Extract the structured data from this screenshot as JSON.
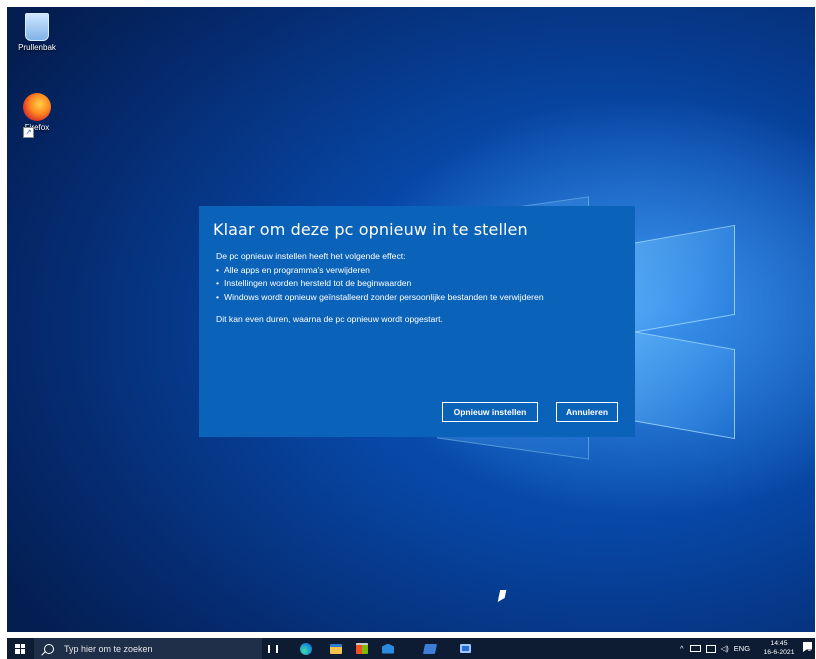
{
  "desktop": {
    "icons": [
      {
        "label": "Prullenbak",
        "icon": "recycle-bin-icon"
      },
      {
        "label": "Firefox",
        "icon": "firefox-icon"
      }
    ]
  },
  "dialog": {
    "title": "Klaar om deze pc opnieuw in te stellen",
    "intro": "De pc opnieuw instellen heeft het volgende effect:",
    "bullets": [
      "Alle apps en programma's verwijderen",
      "Instellingen worden hersteld tot de beginwaarden",
      "Windows wordt opnieuw geïnstalleerd zonder persoonlijke bestanden te verwijderen"
    ],
    "note": "Dit kan even duren, waarna de pc opnieuw wordt opgestart.",
    "reset_label": "Opnieuw instellen",
    "cancel_label": "Annuleren",
    "background": "#0a63b8"
  },
  "taskbar": {
    "search_placeholder": "Typ hier om te zoeken",
    "apps": [
      "task-view-icon",
      "edge-icon",
      "file-explorer-icon",
      "store-icon",
      "mail-icon",
      "photos-icon",
      "app-icon"
    ],
    "tray": {
      "chevron": "^",
      "language": "ENG",
      "time": "14:45",
      "date": "16-6-2021",
      "notification_count": "2"
    },
    "background": "#0d1c33"
  }
}
